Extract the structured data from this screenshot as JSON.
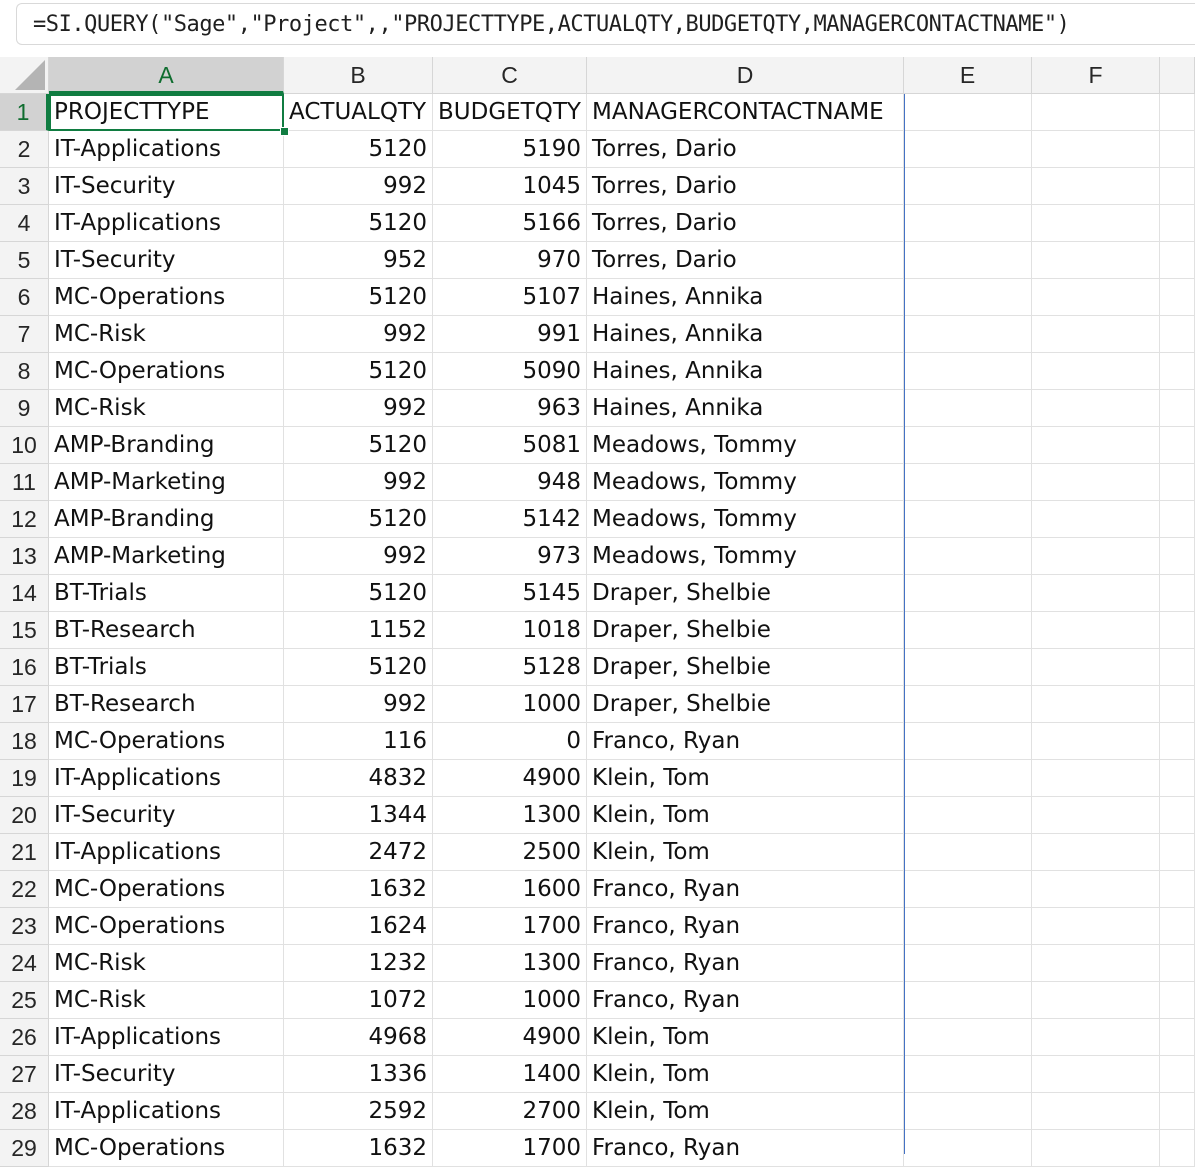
{
  "formula_bar": {
    "formula": "=SI.QUERY(\"Sage\",\"Project\",,\"PROJECTTYPE,ACTUALQTY,BUDGETQTY,MANAGERCONTACTNAME\")"
  },
  "columns": [
    "A",
    "B",
    "C",
    "D",
    "E",
    "F"
  ],
  "selected_cell": "A1",
  "rows": [
    {
      "n": "1",
      "a": "PROJECTTYPE",
      "b": "ACTUALQTY",
      "c": "BUDGETQTY",
      "d": "MANAGERCONTACTNAME"
    },
    {
      "n": "2",
      "a": "IT-Applications",
      "b": "5120",
      "c": "5190",
      "d": "Torres, Dario"
    },
    {
      "n": "3",
      "a": "IT-Security",
      "b": "992",
      "c": "1045",
      "d": "Torres, Dario"
    },
    {
      "n": "4",
      "a": "IT-Applications",
      "b": "5120",
      "c": "5166",
      "d": "Torres, Dario"
    },
    {
      "n": "5",
      "a": "IT-Security",
      "b": "952",
      "c": "970",
      "d": "Torres, Dario"
    },
    {
      "n": "6",
      "a": "MC-Operations",
      "b": "5120",
      "c": "5107",
      "d": "Haines, Annika"
    },
    {
      "n": "7",
      "a": "MC-Risk",
      "b": "992",
      "c": "991",
      "d": "Haines, Annika"
    },
    {
      "n": "8",
      "a": "MC-Operations",
      "b": "5120",
      "c": "5090",
      "d": "Haines, Annika"
    },
    {
      "n": "9",
      "a": "MC-Risk",
      "b": "992",
      "c": "963",
      "d": "Haines, Annika"
    },
    {
      "n": "10",
      "a": "AMP-Branding",
      "b": "5120",
      "c": "5081",
      "d": "Meadows, Tommy"
    },
    {
      "n": "11",
      "a": "AMP-Marketing",
      "b": "992",
      "c": "948",
      "d": "Meadows, Tommy"
    },
    {
      "n": "12",
      "a": "AMP-Branding",
      "b": "5120",
      "c": "5142",
      "d": "Meadows, Tommy"
    },
    {
      "n": "13",
      "a": "AMP-Marketing",
      "b": "992",
      "c": "973",
      "d": "Meadows, Tommy"
    },
    {
      "n": "14",
      "a": "BT-Trials",
      "b": "5120",
      "c": "5145",
      "d": "Draper, Shelbie"
    },
    {
      "n": "15",
      "a": "BT-Research",
      "b": "1152",
      "c": "1018",
      "d": "Draper, Shelbie"
    },
    {
      "n": "16",
      "a": "BT-Trials",
      "b": "5120",
      "c": "5128",
      "d": "Draper, Shelbie"
    },
    {
      "n": "17",
      "a": "BT-Research",
      "b": "992",
      "c": "1000",
      "d": "Draper, Shelbie"
    },
    {
      "n": "18",
      "a": "MC-Operations",
      "b": "116",
      "c": "0",
      "d": "Franco, Ryan"
    },
    {
      "n": "19",
      "a": "IT-Applications",
      "b": "4832",
      "c": "4900",
      "d": "Klein, Tom"
    },
    {
      "n": "20",
      "a": "IT-Security",
      "b": "1344",
      "c": "1300",
      "d": "Klein, Tom"
    },
    {
      "n": "21",
      "a": "IT-Applications",
      "b": "2472",
      "c": "2500",
      "d": "Klein, Tom"
    },
    {
      "n": "22",
      "a": "MC-Operations",
      "b": "1632",
      "c": "1600",
      "d": "Franco, Ryan"
    },
    {
      "n": "23",
      "a": "MC-Operations",
      "b": "1624",
      "c": "1700",
      "d": "Franco, Ryan"
    },
    {
      "n": "24",
      "a": "MC-Risk",
      "b": "1232",
      "c": "1300",
      "d": "Franco, Ryan"
    },
    {
      "n": "25",
      "a": "MC-Risk",
      "b": "1072",
      "c": "1000",
      "d": "Franco, Ryan"
    },
    {
      "n": "26",
      "a": "IT-Applications",
      "b": "4968",
      "c": "4900",
      "d": "Klein, Tom"
    },
    {
      "n": "27",
      "a": "IT-Security",
      "b": "1336",
      "c": "1400",
      "d": "Klein, Tom"
    },
    {
      "n": "28",
      "a": "IT-Applications",
      "b": "2592",
      "c": "2700",
      "d": "Klein, Tom"
    },
    {
      "n": "29",
      "a": "MC-Operations",
      "b": "1632",
      "c": "1700",
      "d": "Franco, Ryan"
    }
  ],
  "colors": {
    "selection": "#107c41",
    "spill_border": "#4472c4",
    "header_bg": "#f3f3f3"
  }
}
